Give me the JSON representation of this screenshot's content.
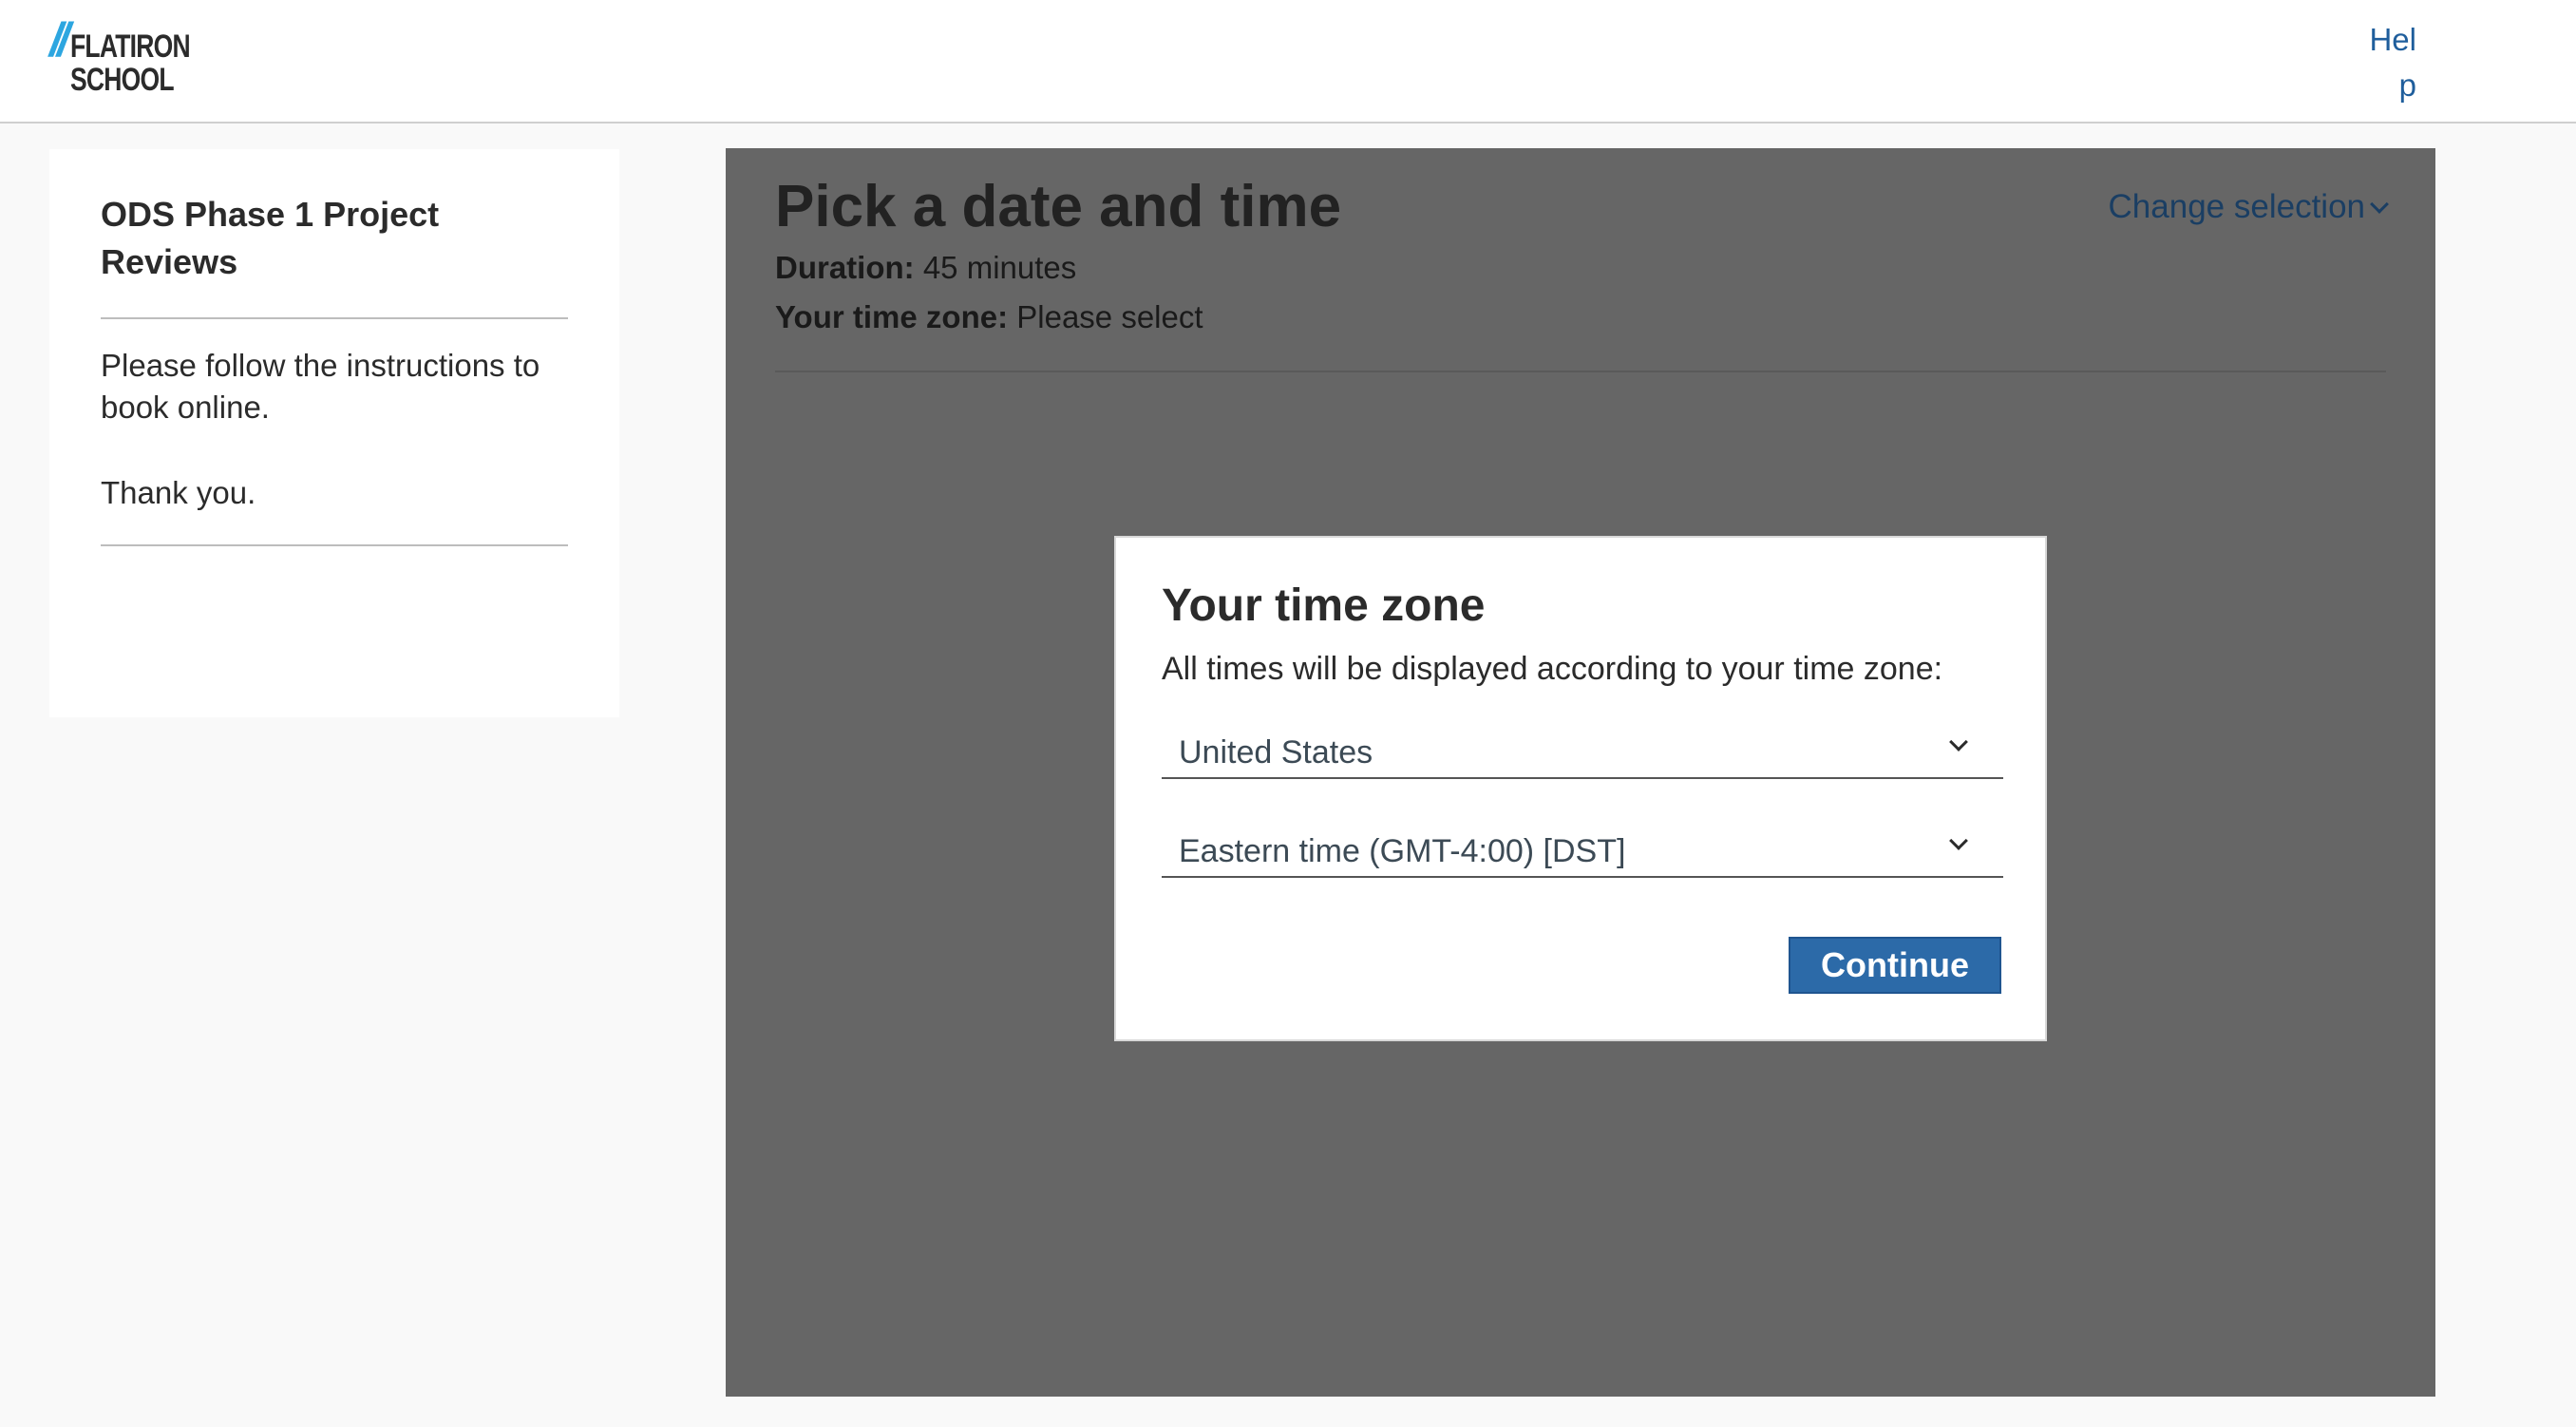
{
  "header": {
    "logo_line1": "FLATIRON",
    "logo_line2": "SCHOOL",
    "help_link": "Help"
  },
  "sidebar": {
    "title": "ODS Phase 1 Project Reviews",
    "instructions": "Please follow the instructions to book online.",
    "thanks": "Thank you."
  },
  "main": {
    "title": "Pick a date and time",
    "change_selection": "Change selection",
    "duration_label": "Duration:",
    "duration_value": "45 minutes",
    "timezone_label": "Your time zone:",
    "timezone_value": "Please select"
  },
  "modal": {
    "title": "Your time zone",
    "description": "All times will be displayed according to your time zone:",
    "country_select": "United States",
    "timezone_select": "Eastern time (GMT-4:00) [DST]",
    "continue_label": "Continue"
  },
  "colors": {
    "accent": "#2c6aa8",
    "link": "#1f5e9c",
    "logo_slash": "#2da6e0",
    "overlay": "#666666"
  }
}
